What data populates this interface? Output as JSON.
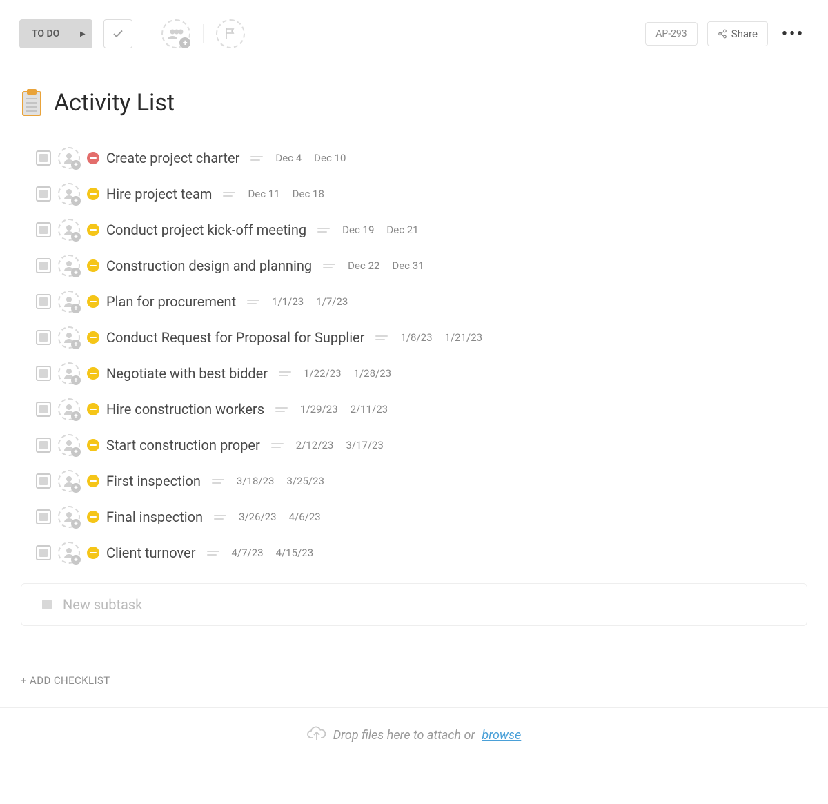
{
  "toolbar": {
    "status_label": "TO DO",
    "ticket_id": "AP-293",
    "share_label": "Share"
  },
  "page": {
    "title": "Activity List",
    "new_subtask_placeholder": "New subtask",
    "add_checklist_label": "+ ADD CHECKLIST",
    "dropzone_text": "Drop files here to attach or ",
    "dropzone_link": "browse"
  },
  "tasks": [
    {
      "name": "Create project charter",
      "start": "Dec 4",
      "end": "Dec 10",
      "priority": "red"
    },
    {
      "name": "Hire project team",
      "start": "Dec 11",
      "end": "Dec 18",
      "priority": "yellow"
    },
    {
      "name": "Conduct project kick-off meeting",
      "start": "Dec 19",
      "end": "Dec 21",
      "priority": "yellow"
    },
    {
      "name": "Construction design and planning",
      "start": "Dec 22",
      "end": "Dec 31",
      "priority": "yellow"
    },
    {
      "name": "Plan for procurement",
      "start": "1/1/23",
      "end": "1/7/23",
      "priority": "yellow"
    },
    {
      "name": "Conduct Request for Proposal for Supplier",
      "start": "1/8/23",
      "end": "1/21/23",
      "priority": "yellow"
    },
    {
      "name": "Negotiate with best bidder",
      "start": "1/22/23",
      "end": "1/28/23",
      "priority": "yellow"
    },
    {
      "name": "Hire construction workers",
      "start": "1/29/23",
      "end": "2/11/23",
      "priority": "yellow"
    },
    {
      "name": "Start construction proper",
      "start": "2/12/23",
      "end": "3/17/23",
      "priority": "yellow"
    },
    {
      "name": "First inspection",
      "start": "3/18/23",
      "end": "3/25/23",
      "priority": "yellow"
    },
    {
      "name": "Final inspection",
      "start": "3/26/23",
      "end": "4/6/23",
      "priority": "yellow"
    },
    {
      "name": "Client turnover",
      "start": "4/7/23",
      "end": "4/15/23",
      "priority": "yellow"
    }
  ]
}
